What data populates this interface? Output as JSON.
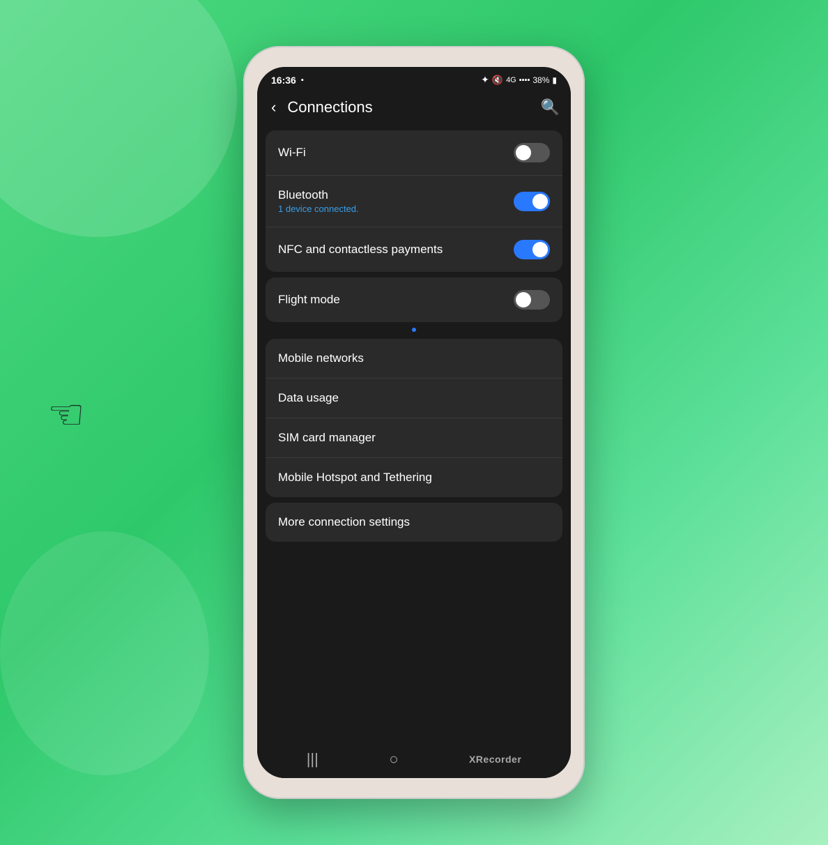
{
  "background": {
    "color": "#4dd880"
  },
  "status_bar": {
    "time": "16:36",
    "camera_icon": "📷",
    "bluetooth_icon": "✦",
    "mute_icon": "🔇",
    "signal_icon": "📶",
    "battery_percent": "38%",
    "battery_icon": "🔋"
  },
  "header": {
    "title": "Connections",
    "back_label": "‹",
    "search_label": "🔍"
  },
  "settings": {
    "group1": {
      "rows": [
        {
          "label": "Wi-Fi",
          "sublabel": "",
          "toggle": true,
          "toggle_on": false
        },
        {
          "label": "Bluetooth",
          "sublabel": "1 device connected.",
          "toggle": true,
          "toggle_on": true
        },
        {
          "label": "NFC and contactless payments",
          "sublabel": "",
          "toggle": true,
          "toggle_on": true
        }
      ]
    },
    "group2": {
      "rows": [
        {
          "label": "Flight mode",
          "sublabel": "",
          "toggle": true,
          "toggle_on": false
        }
      ]
    },
    "group3": {
      "rows": [
        {
          "label": "Mobile networks",
          "sublabel": "",
          "toggle": false
        },
        {
          "label": "Data usage",
          "sublabel": "",
          "toggle": false
        },
        {
          "label": "SIM card manager",
          "sublabel": "",
          "toggle": false
        },
        {
          "label": "Mobile Hotspot and Tethering",
          "sublabel": "",
          "toggle": false
        }
      ]
    },
    "group4": {
      "rows": [
        {
          "label": "More connection settings",
          "sublabel": "",
          "toggle": false
        }
      ]
    }
  },
  "nav_bar": {
    "back_icon": "|||",
    "home_icon": "○",
    "recorder_label": "XRecorder"
  }
}
